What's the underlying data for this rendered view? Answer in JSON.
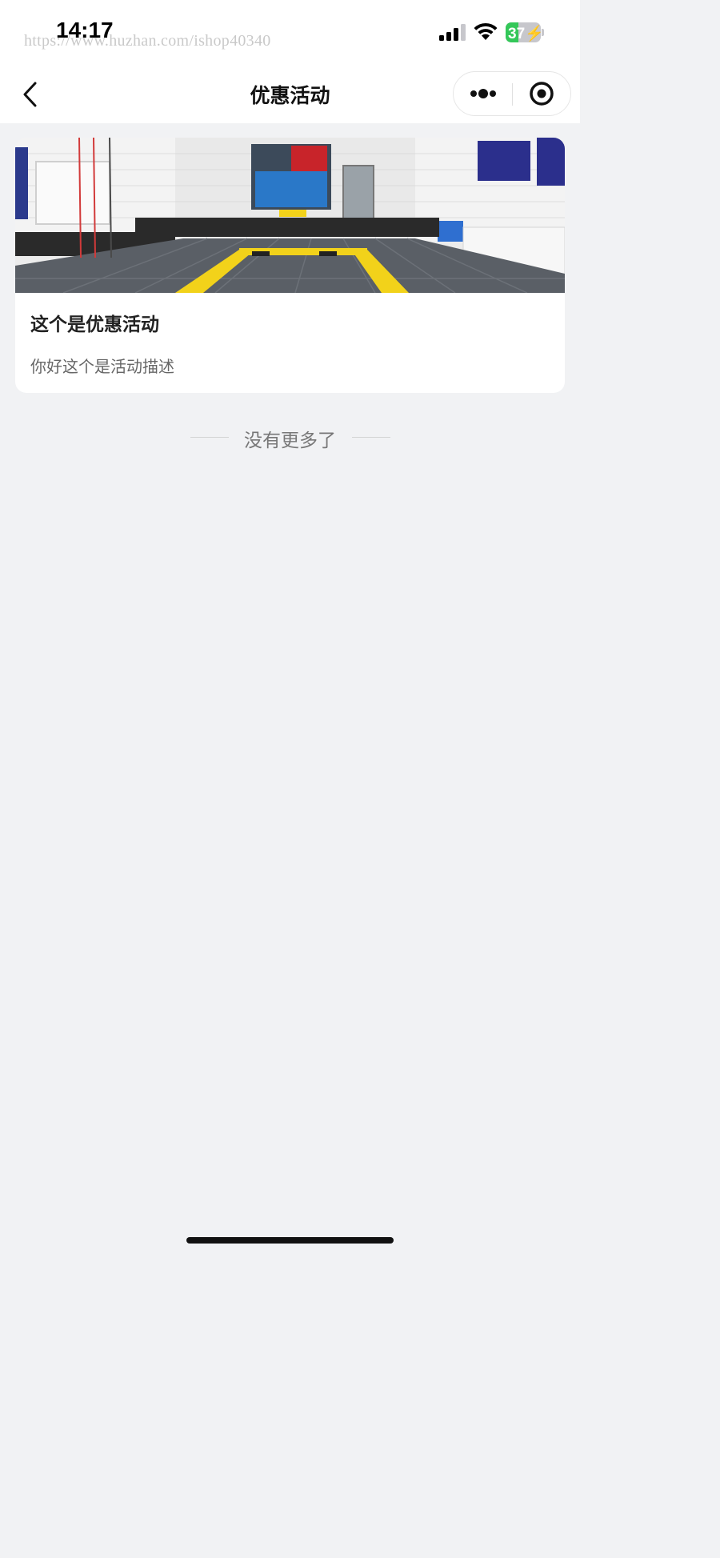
{
  "status_bar": {
    "time": "14:17",
    "watermark": "https://www.huzhan.com/ishop40340",
    "battery_level": "37",
    "battery_fraction": 0.37,
    "battery_color": "#34c759"
  },
  "nav": {
    "title": "优惠活动",
    "back_icon": "chevron-left-icon",
    "more_icon": "more-dots-icon",
    "close_icon": "target-circle-icon"
  },
  "promotions": [
    {
      "title": "这个是优惠活动",
      "description": "你好这个是活动描述",
      "image": "car-wash-bay-photo"
    }
  ],
  "list_end_text": "没有更多了",
  "colors": {
    "page_background": "#f1f2f4",
    "card_background": "#ffffff",
    "accent_yellow": "#f2d21a"
  }
}
